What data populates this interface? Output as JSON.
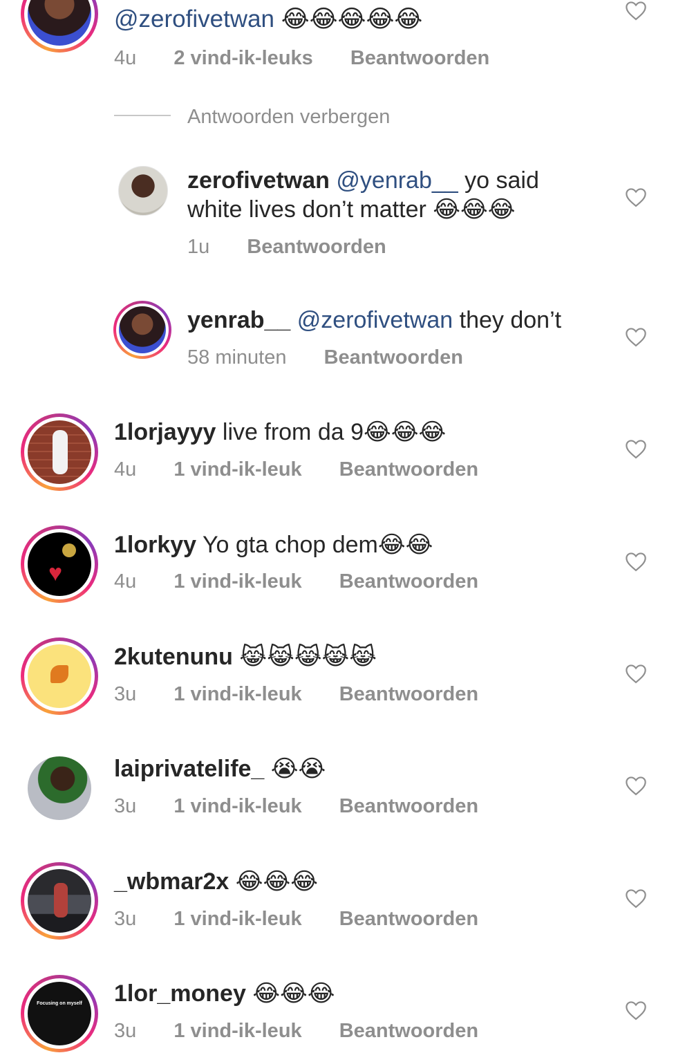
{
  "top_comment": {
    "text": "@zerofivetwan",
    "emoji": "😂😂😂😂😂",
    "time": "4u",
    "likes": "2 vind-ik-leuks",
    "reply_label": "Beantwoorden"
  },
  "hide_replies_label": "Antwoorden verbergen",
  "replies": [
    {
      "username": "zerofivetwan",
      "mention": "@yenrab__",
      "text_line1": "yo said",
      "text_line2": "white lives don’t matter",
      "emoji": "😂😂😂",
      "time": "1u",
      "reply_label": "Beantwoorden"
    },
    {
      "username": "yenrab__",
      "mention": "@zerofivetwan",
      "text": "they don’t",
      "time": "58 minuten",
      "reply_label": "Beantwoorden"
    }
  ],
  "comments": [
    {
      "username": "1lorjayyy",
      "text": "live from da 9",
      "emoji": "😂😂😂",
      "time": "4u",
      "likes": "1 vind-ik-leuk",
      "reply_label": "Beantwoorden"
    },
    {
      "username": "1lorkyy",
      "text": "Yo gta chop dem",
      "emoji": "😂😂",
      "time": "4u",
      "likes": "1 vind-ik-leuk",
      "reply_label": "Beantwoorden"
    },
    {
      "username": "2kutenunu",
      "text": "",
      "emoji": "😹😹😹😹😹",
      "time": "3u",
      "likes": "1 vind-ik-leuk",
      "reply_label": "Beantwoorden"
    },
    {
      "username": "laiprivatelife_",
      "text": "",
      "emoji": "😭😭",
      "time": "3u",
      "likes": "1 vind-ik-leuk",
      "reply_label": "Beantwoorden"
    },
    {
      "username": "_wbmar2x",
      "text": "",
      "emoji": "😂😂😂",
      "time": "3u",
      "likes": "1 vind-ik-leuk",
      "reply_label": "Beantwoorden"
    },
    {
      "username": "1lor_money",
      "text": "",
      "emoji": "😂😂😂",
      "time": "3u",
      "likes": "1 vind-ik-leuk",
      "reply_label": "Beantwoorden"
    }
  ],
  "avatar_texts": {
    "lor_money": "Focusing on myself"
  },
  "icons": {
    "like": "heart-outline-icon"
  },
  "colors": {
    "text": "#262626",
    "meta": "#8e8e8e",
    "mention": "#2f4f80"
  }
}
